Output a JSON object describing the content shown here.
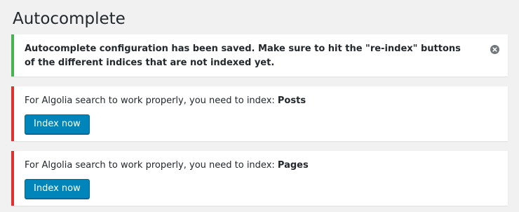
{
  "page": {
    "title": "Autocomplete"
  },
  "notices": {
    "success": {
      "message": "Autocomplete configuration has been saved. Make sure to hit the \"re-index\" buttons of the different indices that are not indexed yet.",
      "dismiss_icon": "close-circle-icon"
    },
    "index_notices": [
      {
        "message_prefix": "For Algolia search to work properly, you need to index:",
        "index_name": "Posts",
        "button_label": "Index now"
      },
      {
        "message_prefix": "For Algolia search to work properly, you need to index:",
        "index_name": "Pages",
        "button_label": "Index now"
      }
    ]
  },
  "colors": {
    "background": "#f1f1f1",
    "success_border": "#46b450",
    "error_border": "#dc3232",
    "button": "#0085ba"
  }
}
